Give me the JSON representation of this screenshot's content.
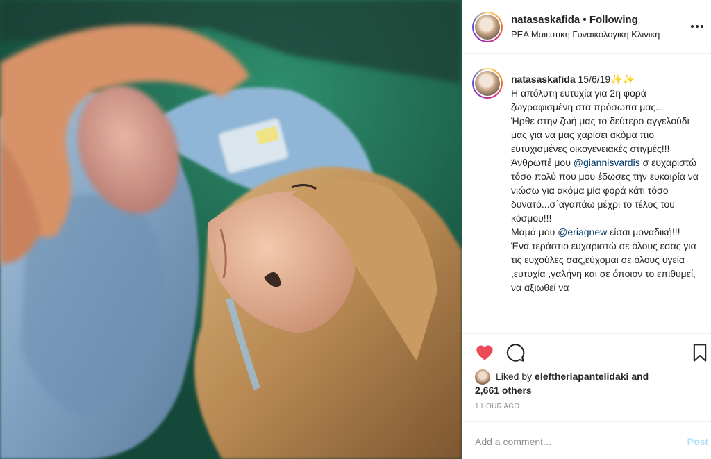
{
  "post": {
    "username": "natasaskafida",
    "separator": " • ",
    "follow_status": "Following",
    "location": "ΡΕΑ Μαιευτικη Γυναικολογικη Κλινικη",
    "caption": {
      "username": "natasaskafida",
      "text_1": " 15/6/19✨✨\nΗ απόλυτη ευτυχία για 2η φορά ζωγραφισμένη στα πρόσωπα μας...\nΉρθε στην ζωή μας το δεύτερο αγγελούδι μας για να μας χαρίσει ακόμα πιο ευτυχισμένες οικογενειακές στιγμές!!!\nΆνθρωπέ μου ",
      "mention_1": "@giannisvardis",
      "text_2": " σ ευχαριστώ τόσο πολύ που μου έδωσες την ευκαιρία να νιώσω για ακόμα μία φορά κάτι τόσο δυνατό...σ΄αγαπάω μέχρι το τέλος του κόσμου!!!\nΜαμά μου ",
      "mention_2": "@eriagnew",
      "text_3": " είσαι μοναδική!!!\nΈνα τεράστιο ευχαριστώ σε όλους εσας για τις ευχούλες σας,εύχομαι σε όλους υγεία ,ευτυχία ,γαλήνη και σε όποιον το επιθυμεί, να αξιωθεί να"
    },
    "likes": {
      "prefix": "Liked by ",
      "liker": "eleftheriapantelidaki",
      "conj": " and",
      "count_text": "2,661 others"
    },
    "timestamp": "1 hour ago",
    "comment_placeholder": "Add a comment...",
    "post_label": "Post"
  },
  "icons": {
    "more": "more-options-icon",
    "like": "heart-icon",
    "comment": "comment-icon",
    "save": "bookmark-icon"
  },
  "colors": {
    "like_red": "#ed4956",
    "mention": "#003569",
    "post_disabled": "#b2dffc",
    "meta_grey": "#8e8e8e",
    "text": "#262626"
  }
}
